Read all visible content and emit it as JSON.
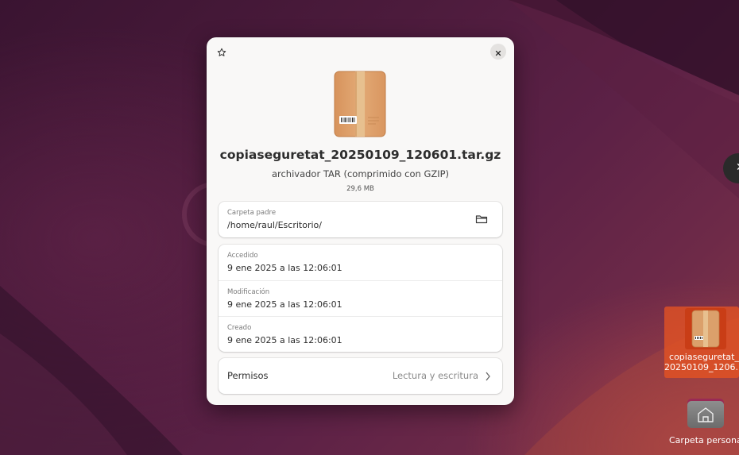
{
  "dialog": {
    "file_name": "copiaseguretat_20250109_120601.tar.gz",
    "file_type": "archivador TAR (comprimido con GZIP)",
    "file_size": "29,6 MB",
    "star_icon": "star-icon",
    "close_icon": "close-icon",
    "parent": {
      "label": "Carpeta padre",
      "value": "/home/raul/Escritorio/",
      "action_icon": "folder-open-icon"
    },
    "dates": [
      {
        "label": "Accedido",
        "value": "9 ene 2025 a las 12:06:01"
      },
      {
        "label": "Modificación",
        "value": "9 ene 2025 a las 12:06:01"
      },
      {
        "label": "Creado",
        "value": "9 ene 2025 a las 12:06:01"
      }
    ],
    "permissions": {
      "label": "Permisos",
      "value": "Lectura y escritura",
      "chevron_icon": "chevron-right-icon"
    }
  },
  "desktop": {
    "file_icon_label": "copiaseguretat_\n20250109_1206...",
    "home_label": "Carpeta personal",
    "side_button_icon": "close-icon",
    "side_button_glyph": "✕"
  },
  "colors": {
    "accent": "#e95420",
    "dialog_bg": "#f9f8f7",
    "package": "#dba06b"
  }
}
